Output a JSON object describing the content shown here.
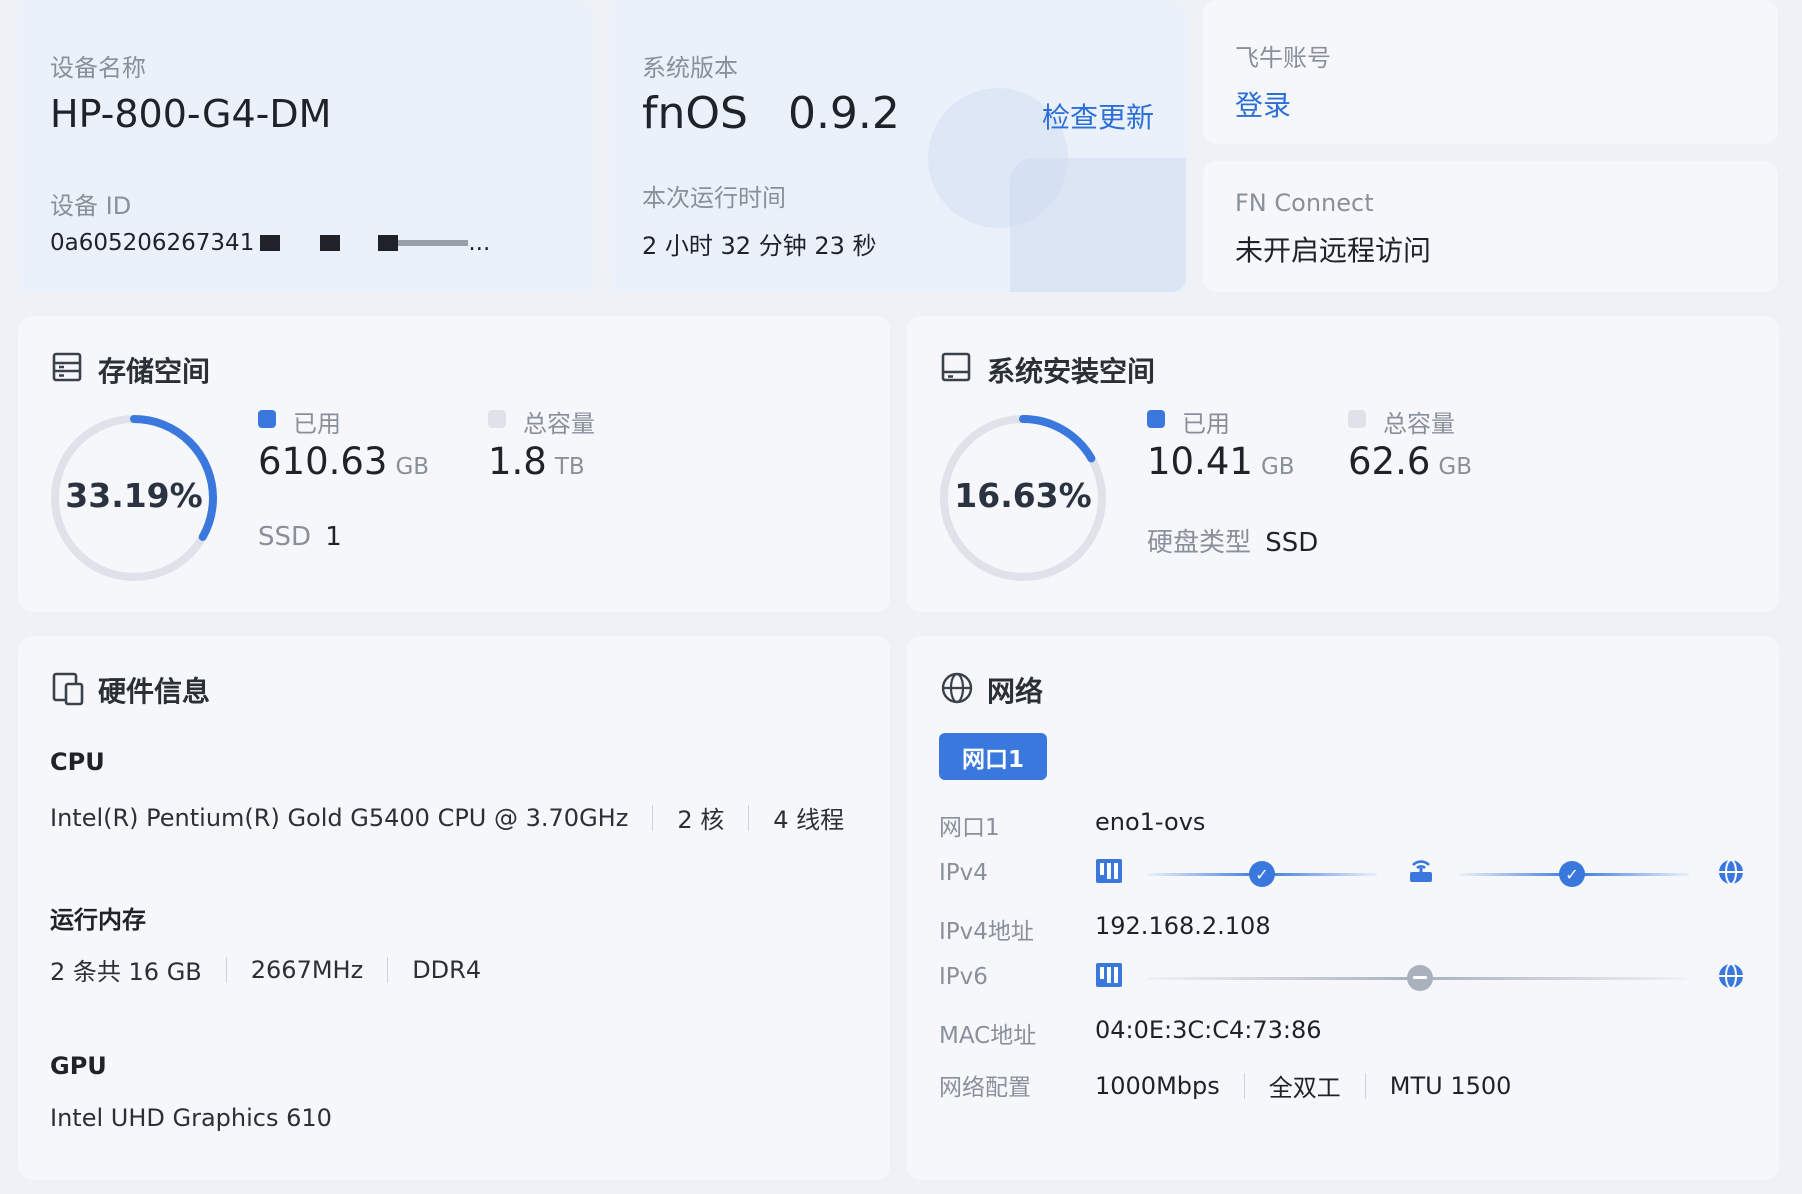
{
  "device": {
    "name_label": "设备名称",
    "name_value": "HP-800-G4-DM",
    "id_label": "设备 ID",
    "id_value": "0a605206267341",
    "id_tail": "..."
  },
  "system": {
    "version_label": "系统版本",
    "os_name": "fnOS",
    "os_version": "0.9.2",
    "check_update": "检查更新",
    "uptime_label": "本次运行时间",
    "uptime_value": "2 小时 32 分钟 23 秒"
  },
  "account": {
    "label": "飞牛账号",
    "login": "登录"
  },
  "connect": {
    "label": "FN Connect",
    "status": "未开启远程访问"
  },
  "storage": {
    "title": "存储空间",
    "percent_text": "33.19%",
    "percent": 33.19,
    "used_label": "已用",
    "used_value": "610.63",
    "used_unit": "GB",
    "total_label": "总容量",
    "total_value": "1.8",
    "total_unit": "TB",
    "ssd_label": "SSD",
    "ssd_value": "1"
  },
  "sysinstall": {
    "title": "系统安装空间",
    "percent_text": "16.63%",
    "percent": 16.63,
    "used_label": "已用",
    "used_value": "10.41",
    "used_unit": "GB",
    "total_label": "总容量",
    "total_value": "62.6",
    "total_unit": "GB",
    "disk_type_label": "硬盘类型",
    "disk_type_value": "SSD"
  },
  "hardware": {
    "title": "硬件信息",
    "cpu_label": "CPU",
    "cpu_model": "Intel(R) Pentium(R) Gold G5400 CPU @ 3.70GHz",
    "cpu_cores": "2 核",
    "cpu_threads": "4 线程",
    "mem_label": "运行内存",
    "mem_size": "2 条共 16 GB",
    "mem_freq": "2667MHz",
    "mem_type": "DDR4",
    "gpu_label": "GPU",
    "gpu_model": "Intel UHD Graphics 610"
  },
  "network": {
    "title": "网络",
    "tab": "网口1",
    "port_label": "网口1",
    "port_value": "eno1-ovs",
    "ipv4_label": "IPv4",
    "ipv4_addr_label": "IPv4地址",
    "ipv4_addr_value": "192.168.2.108",
    "ipv6_label": "IPv6",
    "mac_label": "MAC地址",
    "mac_value": "04:0E:3C:C4:73:86",
    "config_label": "网络配置",
    "config_speed": "1000Mbps",
    "config_duplex": "全双工",
    "config_mtu": "MTU 1500"
  },
  "colors": {
    "accent": "#3a78dd",
    "ring_track": "#dfe2e8",
    "legend_total": "#dfe2e8"
  }
}
